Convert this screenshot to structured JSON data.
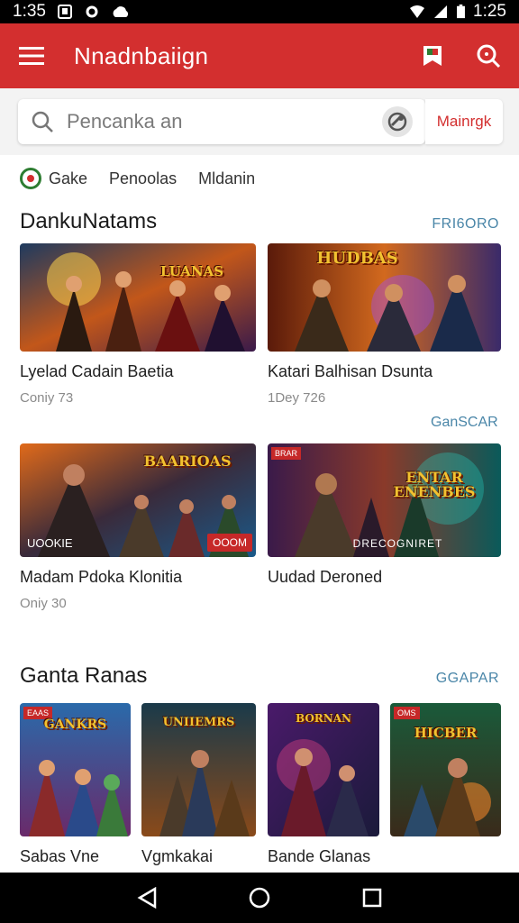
{
  "status_bar": {
    "time_left": "1:35",
    "time_right": "1:25"
  },
  "app_bar": {
    "title": "Nnadnbaiign"
  },
  "search": {
    "placeholder": "Pencanka an",
    "button_label": "Mainrgk"
  },
  "tabs": [
    {
      "label": "Gake"
    },
    {
      "label": "Penoolas"
    },
    {
      "label": "Mldanin"
    }
  ],
  "section1": {
    "title": "DankuNatams",
    "more_label": "FRI6ORO",
    "sub_label": "GanSCAR",
    "cards": [
      {
        "title": "Lyelad Cadain Baetia",
        "meta": "Coniy 73",
        "logo": "LUANAS"
      },
      {
        "title": "Katari Balhisan Dsunta",
        "meta": "1Dey 726",
        "logo": "HUDBAS"
      },
      {
        "title": "Madam Pdoka Klonitia",
        "meta": "Oniy 30",
        "logo": "BAARIOAS",
        "corner": "UOOKIE",
        "badge": "OOOM"
      },
      {
        "title": "Uudad Deroned",
        "meta": "",
        "logo": "ENTAR ENENBES",
        "caption": "DRECOGNIRET",
        "corner_tl": "BRAR"
      }
    ]
  },
  "section2": {
    "title": "Ganta Ranas",
    "more_label": "GGAPAR",
    "cards": [
      {
        "title": "Sabas Vne",
        "logo": "GANKRS",
        "corner_tl": "EAAS"
      },
      {
        "title": "Vgmkakai",
        "logo": "UNIIEMRS"
      },
      {
        "title": "Bande Glanas",
        "logo": "BORNAN"
      },
      {
        "title": "",
        "logo": "HICBER",
        "corner_tl": "OMS"
      }
    ]
  },
  "colors": {
    "app_bar": "#d32f2f",
    "accent_link": "#4a86a8"
  }
}
